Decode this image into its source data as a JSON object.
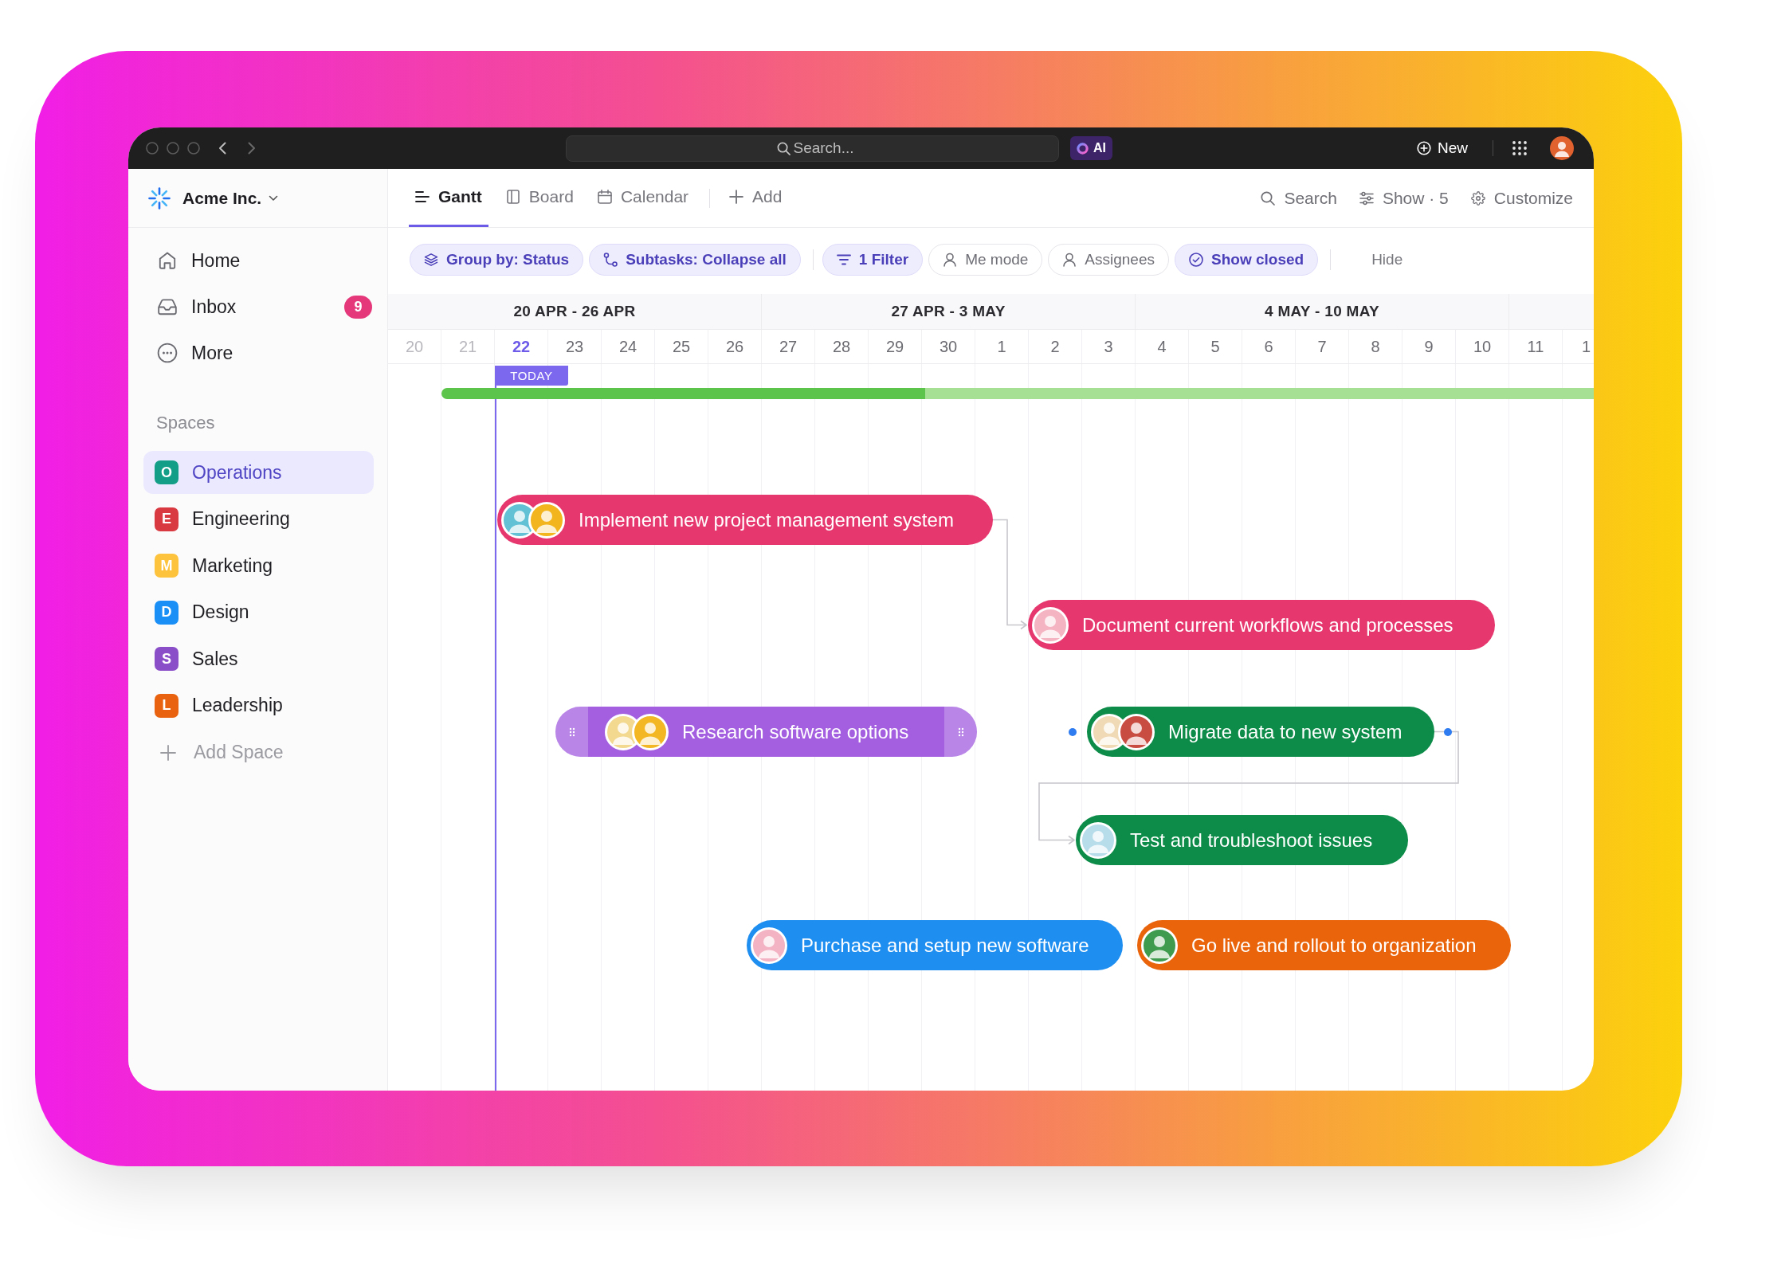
{
  "title_bar": {
    "search": {
      "placeholder": "Search..."
    },
    "ai_button": "AI",
    "new_button": "New",
    "user_avatar": {
      "color": "#e2622f"
    }
  },
  "sidebar": {
    "workspace": "Acme Inc.",
    "nav": [
      {
        "label": "Home"
      },
      {
        "label": "Inbox",
        "badge": "9"
      },
      {
        "label": "More"
      }
    ],
    "spaces_heading": "Spaces",
    "spaces": [
      {
        "initial": "O",
        "label": "Operations",
        "color": "#129e87",
        "selected": true
      },
      {
        "initial": "E",
        "label": "Engineering",
        "color": "#d93a42",
        "selected": false
      },
      {
        "initial": "M",
        "label": "Marketing",
        "color": "#fdc33c",
        "selected": false
      },
      {
        "initial": "D",
        "label": "Design",
        "color": "#1a8ff5",
        "selected": false
      },
      {
        "initial": "S",
        "label": "Sales",
        "color": "#8a4ec8",
        "selected": false
      },
      {
        "initial": "L",
        "label": "Leadership",
        "color": "#e8620f",
        "selected": false
      }
    ],
    "add_space": "Add Space"
  },
  "view_tabs": [
    {
      "label": "Gantt",
      "selected": true
    },
    {
      "label": "Board",
      "selected": false
    },
    {
      "label": "Calendar",
      "selected": false
    }
  ],
  "add_view": "Add",
  "toolbar": [
    "Search",
    "Show · 5",
    "Customize"
  ],
  "filters": [
    {
      "label": "Group by: Status",
      "active": true
    },
    {
      "label": "Subtasks: Collapse all",
      "active": true
    },
    {
      "label": "1 Filter",
      "active": true
    },
    {
      "label": "Me mode",
      "active": false
    },
    {
      "label": "Assignees",
      "active": false
    },
    {
      "label": "Show closed",
      "active": true
    }
  ],
  "hide": "Hide",
  "gantt": {
    "weeks": [
      "20 APR - 26 APR",
      "27 APR - 3 MAY",
      "4 MAY - 10 MAY"
    ],
    "days": [
      {
        "label": "20",
        "past": true,
        "today": false
      },
      {
        "label": "21",
        "past": true,
        "today": false
      },
      {
        "label": "22",
        "past": false,
        "today": true
      },
      {
        "label": "23",
        "past": false,
        "today": false
      },
      {
        "label": "24",
        "past": false,
        "today": false
      },
      {
        "label": "25",
        "past": false,
        "today": false
      },
      {
        "label": "26",
        "past": false,
        "today": false
      },
      {
        "label": "27",
        "past": false,
        "today": false
      },
      {
        "label": "28",
        "past": false,
        "today": false
      },
      {
        "label": "29",
        "past": false,
        "today": false
      },
      {
        "label": "30",
        "past": false,
        "today": false
      },
      {
        "label": "1",
        "past": false,
        "today": false
      },
      {
        "label": "2",
        "past": false,
        "today": false
      },
      {
        "label": "3",
        "past": false,
        "today": false
      },
      {
        "label": "4",
        "past": false,
        "today": false
      },
      {
        "label": "5",
        "past": false,
        "today": false
      },
      {
        "label": "6",
        "past": false,
        "today": false
      },
      {
        "label": "7",
        "past": false,
        "today": false
      },
      {
        "label": "8",
        "past": false,
        "today": false
      },
      {
        "label": "9",
        "past": false,
        "today": false
      },
      {
        "label": "10",
        "past": false,
        "today": false
      },
      {
        "label": "11",
        "past": false,
        "today": false
      },
      {
        "label": "1",
        "past": false,
        "today": false
      }
    ],
    "today_marker": "TODAY",
    "progress": {
      "level": 0.42
    },
    "tasks": [
      {
        "name": "Implement new project management system",
        "color": "#e6386f",
        "avatars": [
          {
            "color": "#62c1d4"
          },
          {
            "color": "#f3b51d"
          }
        ],
        "drag_handles": false,
        "link_points": false,
        "link_to_next": true
      },
      {
        "name": "Document current workflows and processes",
        "color": "#e6386f",
        "avatars": [
          {
            "color": "#f5b4c2"
          }
        ],
        "drag_handles": false,
        "link_points": false,
        "link_to_next": false
      },
      {
        "name": "Research software options",
        "color": "#a35fe0",
        "avatars": [
          {
            "color": "#f2d98f"
          },
          {
            "color": "#f2b722"
          }
        ],
        "drag_handles": true,
        "link_points": false,
        "link_to_next": false
      },
      {
        "name": "Migrate data to new system",
        "color": "#0c8c48",
        "avatars": [
          {
            "color": "#f0d9b5"
          },
          {
            "color": "#c94c43"
          }
        ],
        "drag_handles": false,
        "link_points": true,
        "link_to_next": true
      },
      {
        "name": "Test and troubleshoot issues",
        "color": "#0c8c48",
        "avatars": [
          {
            "color": "#b7dcea"
          }
        ],
        "drag_handles": false,
        "link_points": false,
        "link_to_next": false
      },
      {
        "name": "Purchase and setup new software",
        "color": "#1e8ef0",
        "avatars": [
          {
            "color": "#f3b3c3"
          }
        ],
        "drag_handles": false,
        "link_points": false,
        "link_to_next": false
      },
      {
        "name": "Go live and rollout to organization",
        "color": "#e9640b",
        "avatars": [
          {
            "color": "#3f9b4d"
          }
        ],
        "drag_handles": false,
        "link_points": false,
        "link_to_next": false
      }
    ]
  }
}
